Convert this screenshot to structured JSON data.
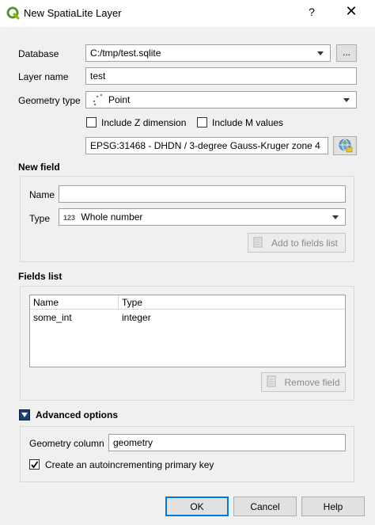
{
  "window": {
    "title": "New SpatiaLite Layer",
    "help_glyph": "?",
    "close_glyph": "✕"
  },
  "form": {
    "database_label": "Database",
    "database_value": "C:/tmp/test.sqlite",
    "browse_label": "...",
    "layer_name_label": "Layer name",
    "layer_name_value": "test",
    "geometry_type_label": "Geometry type",
    "geometry_type_value": "Point",
    "include_z_label": "Include Z dimension",
    "include_z_checked": false,
    "include_m_label": "Include M values",
    "include_m_checked": false,
    "crs_value": "EPSG:31468 - DHDN / 3-degree Gauss-Kruger zone 4"
  },
  "new_field": {
    "section_title": "New field",
    "name_label": "Name",
    "name_value": "",
    "type_label": "Type",
    "type_prefix": "123",
    "type_value": "Whole number",
    "add_button_label": "Add to fields list"
  },
  "fields_list": {
    "section_title": "Fields list",
    "columns": [
      "Name",
      "Type"
    ],
    "rows": [
      {
        "name": "some_int",
        "type": "integer"
      }
    ],
    "remove_button_label": "Remove field"
  },
  "advanced": {
    "section_title": "Advanced options",
    "geometry_column_label": "Geometry column",
    "geometry_column_value": "geometry",
    "autoincrement_label": "Create an autoincrementing primary key",
    "autoincrement_checked": true
  },
  "buttons": {
    "ok": "OK",
    "cancel": "Cancel",
    "help": "Help"
  }
}
